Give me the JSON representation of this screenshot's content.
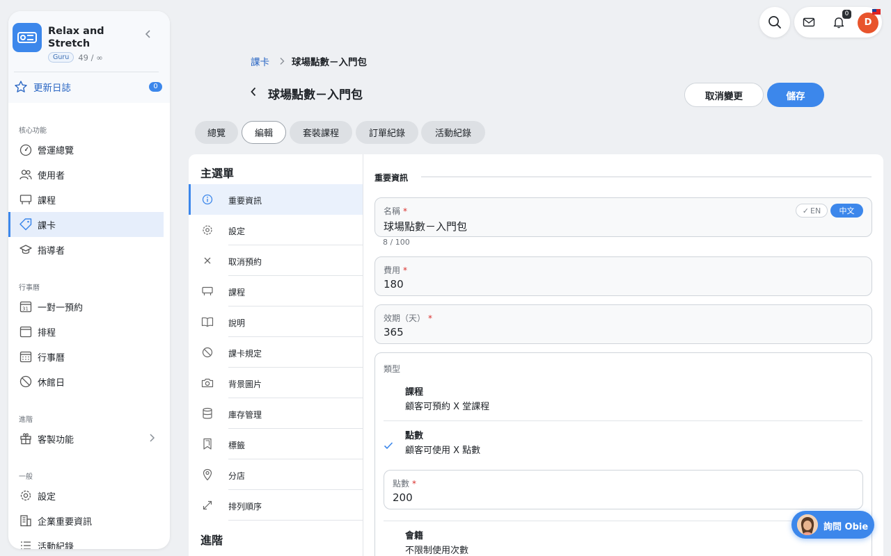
{
  "brand": {
    "name": "Relax and Stretch",
    "plan": "Guru",
    "quota": "49 / ∞",
    "changelog_label": "更新日誌",
    "changelog_count": "0"
  },
  "sidebar": {
    "sections": [
      {
        "title": "核心功能",
        "items": [
          {
            "label": "營運總覽",
            "icon": "dashboard-icon"
          },
          {
            "label": "使用者",
            "icon": "users-icon"
          },
          {
            "label": "課程",
            "icon": "class-board-icon"
          },
          {
            "label": "課卡",
            "icon": "tag-icon",
            "active": true
          },
          {
            "label": "指導者",
            "icon": "graduation-cap-icon"
          }
        ]
      },
      {
        "title": "行事曆",
        "items": [
          {
            "label": "一對一預約",
            "icon": "calendar-31-icon"
          },
          {
            "label": "排程",
            "icon": "calendar-icon"
          },
          {
            "label": "行事曆",
            "icon": "calendar-grid-icon"
          },
          {
            "label": "休館日",
            "icon": "ban-icon"
          }
        ]
      },
      {
        "title": "進階",
        "items": [
          {
            "label": "客製功能",
            "icon": "gift-icon"
          }
        ]
      },
      {
        "title": "一般",
        "items": [
          {
            "label": "設定",
            "icon": "gear-icon"
          },
          {
            "label": "企業重要資訊",
            "icon": "building-icon"
          },
          {
            "label": "活動紀錄",
            "icon": "list-icon"
          }
        ]
      }
    ]
  },
  "topbar": {
    "notification_count": "0",
    "avatar_initial": "D"
  },
  "header": {
    "breadcrumb_root": "課卡",
    "breadcrumb_current": "球場點數－入門包",
    "title": "球場點數－入門包",
    "cancel_label": "取消變更",
    "save_label": "儲存"
  },
  "tabs": [
    {
      "label": "總覽"
    },
    {
      "label": "編輯",
      "active": true
    },
    {
      "label": "套裝課程"
    },
    {
      "label": "訂單紀錄"
    },
    {
      "label": "活動紀錄"
    }
  ],
  "submenu": {
    "title": "主選單",
    "items": [
      {
        "label": "重要資訊",
        "icon": "info-icon",
        "active": true
      },
      {
        "label": "設定",
        "icon": "gear-icon"
      },
      {
        "label": "取消預約",
        "icon": "close-icon"
      },
      {
        "label": "課程",
        "icon": "class-board-icon"
      },
      {
        "label": "說明",
        "icon": "book-icon"
      },
      {
        "label": "課卡規定",
        "icon": "ban-icon"
      },
      {
        "label": "背景圖片",
        "icon": "camera-icon"
      },
      {
        "label": "庫存管理",
        "icon": "database-icon"
      },
      {
        "label": "標籤",
        "icon": "bookmark-icon"
      },
      {
        "label": "分店",
        "icon": "location-pin-icon"
      },
      {
        "label": "排列順序",
        "icon": "resize-arrows-icon"
      }
    ],
    "advanced_title": "進階"
  },
  "form": {
    "section_title": "重要資訊",
    "name": {
      "label": "名稱",
      "value": "球場點數－入門包",
      "char_count": "8 / 100",
      "lang_en": "EN",
      "lang_zh": "中文"
    },
    "price": {
      "label": "費用",
      "value": "180"
    },
    "validity": {
      "label": "效期（天）",
      "value": "365"
    },
    "type": {
      "label": "類型",
      "options": [
        {
          "title": "課程",
          "desc": "顧客可預約 X 堂課程",
          "selected": false
        },
        {
          "title": "點數",
          "desc": "顧客可使用 X 點數",
          "selected": true
        },
        {
          "title": "會籍",
          "desc": "不限制使用次數",
          "selected": false
        }
      ],
      "points": {
        "label": "點數",
        "value": "200"
      }
    }
  },
  "assistant": {
    "label": "詢問 Obie"
  },
  "colors": {
    "accent": "#3c87eb",
    "danger": "#d9302c",
    "background": "#eef0f3"
  }
}
